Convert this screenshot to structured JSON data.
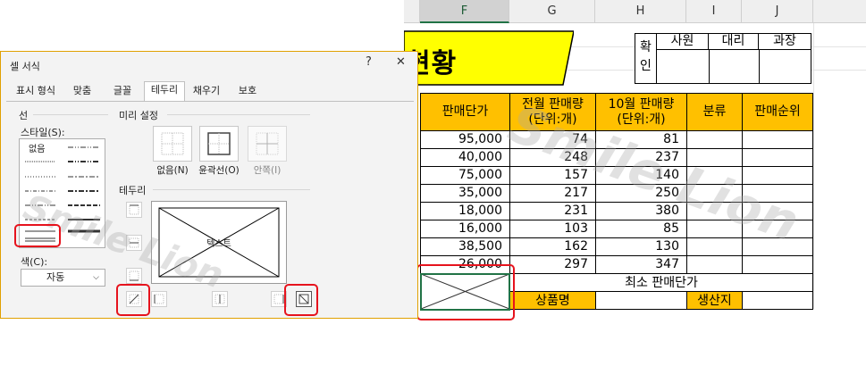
{
  "sheet": {
    "columns": [
      "F",
      "G",
      "H",
      "I",
      "J"
    ],
    "title": "현황",
    "approval": {
      "side": "확인",
      "cols": [
        "사원",
        "대리",
        "과장"
      ]
    },
    "headers": [
      {
        "line1": "판매단가",
        "line2": ""
      },
      {
        "line1": "전월 판매량",
        "line2": "(단위:개)"
      },
      {
        "line1": "10월 판매량",
        "line2": "(단위:개)"
      },
      {
        "line1": "분류",
        "line2": ""
      },
      {
        "line1": "판매순위",
        "line2": ""
      }
    ],
    "rows": [
      [
        "95,000",
        "74",
        "81"
      ],
      [
        "40,000",
        "248",
        "237"
      ],
      [
        "75,000",
        "157",
        "140"
      ],
      [
        "35,000",
        "217",
        "250"
      ],
      [
        "18,000",
        "231",
        "380"
      ],
      [
        "16,000",
        "103",
        "85"
      ],
      [
        "38,500",
        "162",
        "130"
      ],
      [
        "26,000",
        "297",
        "347"
      ]
    ],
    "min_label": "최소 판매단가",
    "product_label": "상품명",
    "origin_label": "생산지"
  },
  "dialog": {
    "title": "셀 서식",
    "help": "?",
    "close": "✕",
    "tabs": [
      "표시 형식",
      "맞춤",
      "글꼴",
      "테두리",
      "채우기",
      "보호"
    ],
    "active_tab": "테두리",
    "line_group": "선",
    "style_label": "스타일(S):",
    "style_none": "없음",
    "presets_group": "미리 설정",
    "presets": [
      "없음(N)",
      "윤곽선(O)",
      "안쪽(I)"
    ],
    "border_group": "테두리",
    "preview_text": "텍스트",
    "color_label": "색(C):",
    "color_value": "자동"
  },
  "watermark": "Smile Lion",
  "colors": {
    "accent": "#ffc000",
    "highlight": "#e6131d",
    "title_fill": "#ffff00"
  }
}
